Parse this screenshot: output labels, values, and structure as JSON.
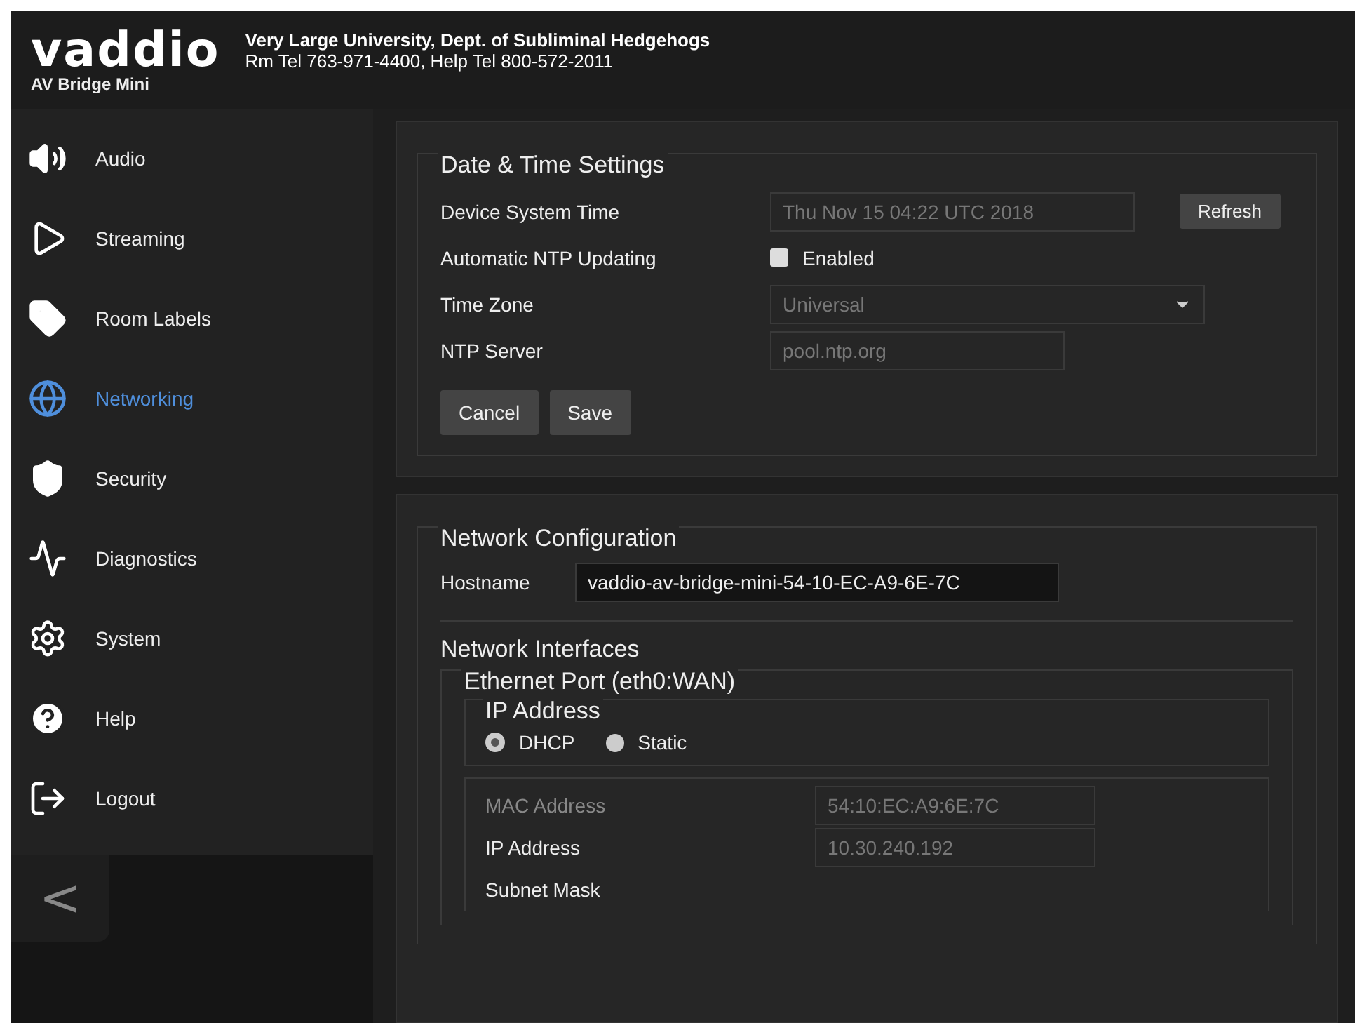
{
  "header": {
    "logo": "vaddio",
    "product": "AV Bridge Mini",
    "org": "Very Large University, Dept. of Subliminal Hedgehogs",
    "phones": "Rm Tel 763-971-4400, Help Tel 800-572-2011"
  },
  "sidebar": {
    "items": [
      {
        "label": "Audio",
        "selected": false
      },
      {
        "label": "Streaming",
        "selected": false
      },
      {
        "label": "Room Labels",
        "selected": false
      },
      {
        "label": "Networking",
        "selected": true
      },
      {
        "label": "Security",
        "selected": false
      },
      {
        "label": "Diagnostics",
        "selected": false
      },
      {
        "label": "System",
        "selected": false
      },
      {
        "label": "Help",
        "selected": false
      },
      {
        "label": "Logout",
        "selected": false
      }
    ],
    "collapse": "<"
  },
  "date_time": {
    "title": "Date & Time Settings",
    "rows": [
      {
        "kind": "text",
        "label": "Device System Time",
        "value": "Thu Nov 15 04:22 UTC 2018",
        "disabled": true,
        "button": "Refresh"
      },
      {
        "kind": "checkbox",
        "label": "Automatic NTP Updating",
        "option": "Enabled",
        "checked": false
      },
      {
        "kind": "select",
        "label": "Time Zone",
        "value": "Universal",
        "disabled": true
      },
      {
        "kind": "text",
        "label": "NTP Server",
        "value": "pool.ntp.org",
        "disabled": true
      }
    ],
    "buttons": [
      "Cancel",
      "Save"
    ]
  },
  "network": {
    "title": "Network Configuration",
    "hostname": {
      "label": "Hostname",
      "value": "vaddio-av-bridge-mini-54-10-EC-A9-6E-7C"
    },
    "interfaces_title": "Network Interfaces",
    "port": {
      "title": "Ethernet Port (eth0:WAN)",
      "ip_mode": {
        "title": "IP Address",
        "options": [
          {
            "label": "DHCP",
            "selected": true
          },
          {
            "label": "Static",
            "selected": false
          }
        ]
      },
      "fields": [
        {
          "label": "MAC Address",
          "value": "54:10:EC:A9:6E:7C",
          "disabled": true
        },
        {
          "label": "IP Address",
          "value": "10.30.240.192",
          "disabled": false
        },
        {
          "label": "Subnet Mask",
          "disabled": false
        }
      ]
    }
  }
}
